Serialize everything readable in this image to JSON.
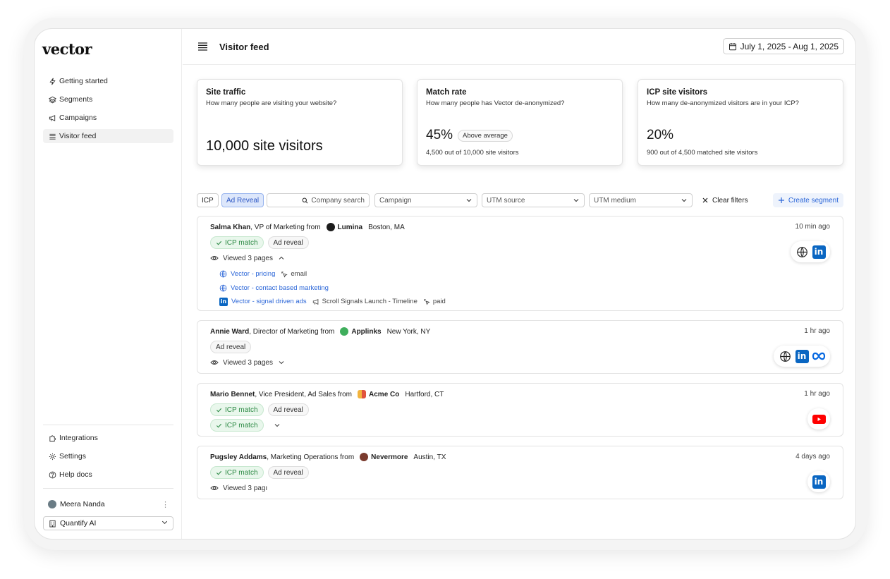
{
  "app": {
    "logo": "vector"
  },
  "sidebar": {
    "nav": [
      {
        "label": "Getting started",
        "icon": "lightning-icon"
      },
      {
        "label": "Segments",
        "icon": "layers-icon"
      },
      {
        "label": "Campaigns",
        "icon": "megaphone-icon"
      },
      {
        "label": "Visitor feed",
        "icon": "list-icon",
        "active": true
      }
    ],
    "bottom_nav": [
      {
        "label": "Integrations",
        "icon": "puzzle-icon"
      },
      {
        "label": "Settings",
        "icon": "gear-icon"
      },
      {
        "label": "Help docs",
        "icon": "help-icon"
      }
    ],
    "user": {
      "name": "Meera Nanda"
    },
    "org": {
      "name": "Quantify AI"
    }
  },
  "header": {
    "title": "Visitor feed",
    "date_range": "July 1, 2025 - Aug 1, 2025"
  },
  "stats": [
    {
      "title": "Site traffic",
      "desc": "How many people are visiting your website?",
      "value": "10,000 site visitors"
    },
    {
      "title": "Match rate",
      "desc": "How many people has Vector de-anonymized?",
      "value": "45%",
      "badge": "Above average",
      "sub": "4,500 out of 10,000 site visitors"
    },
    {
      "title": "ICP site visitors",
      "desc": "How many de-anonymized visitors are in your ICP?",
      "value": "20%",
      "sub": "900 out of 4,500 matched site visitors"
    }
  ],
  "filters": {
    "icp": "ICP",
    "ad_reveal": "Ad Reveal",
    "search_placeholder": "Company search",
    "campaign": "Campaign",
    "utm_source": "UTM source",
    "utm_medium": "UTM medium",
    "clear": "Clear filters",
    "create": "Create segment"
  },
  "visitors": [
    {
      "name": "Salma Khan",
      "title": ", VP of Marketing from",
      "company": "Lumina",
      "location": "Boston, MA",
      "time": "10 min ago",
      "badges": [
        "ICP match",
        "Ad reveal"
      ],
      "viewed": "Viewed 3 pages",
      "pages": [
        {
          "label": "Vector - pricing",
          "source": "web",
          "meta": "email"
        },
        {
          "label": "Vector - contact based marketing",
          "source": "web"
        },
        {
          "label": "Vector - signal driven ads",
          "source": "linkedin",
          "campaign": "Scroll Signals Launch - Timeline",
          "meta": "paid"
        }
      ],
      "channels": [
        "web",
        "linkedin"
      ]
    },
    {
      "name": "Annie Ward",
      "title": ", Director of Marketing from",
      "company": "Applinks",
      "location": "New York, NY",
      "time": "1 hr ago",
      "badges": [
        "Ad reveal"
      ],
      "viewed": "Viewed 3 pages",
      "channels": [
        "web",
        "linkedin",
        "meta"
      ]
    },
    {
      "name": "Mario Bennet",
      "title": ", Vice President, Ad Sales from",
      "company": "Acme Co",
      "location": "Hartford, CT",
      "time": "1 hr ago",
      "badges": [
        "ICP match",
        "Ad reveal"
      ],
      "badge2": "ICP match",
      "channels": [
        "youtube"
      ]
    },
    {
      "name": "Pugsley Addams",
      "title": ", Marketing Operations from",
      "company": "Nevermore",
      "location": "Austin, TX",
      "time": "4 days ago",
      "badges": [
        "ICP match",
        "Ad reveal"
      ],
      "viewed": "Viewed 3 pagı",
      "channels": [
        "linkedin"
      ]
    }
  ],
  "colors": {
    "accent": "#2b66d8",
    "icp_green": "#2d8a45",
    "linkedin": "#0a66c2",
    "youtube": "#ff0000",
    "meta": "#0668e1"
  }
}
